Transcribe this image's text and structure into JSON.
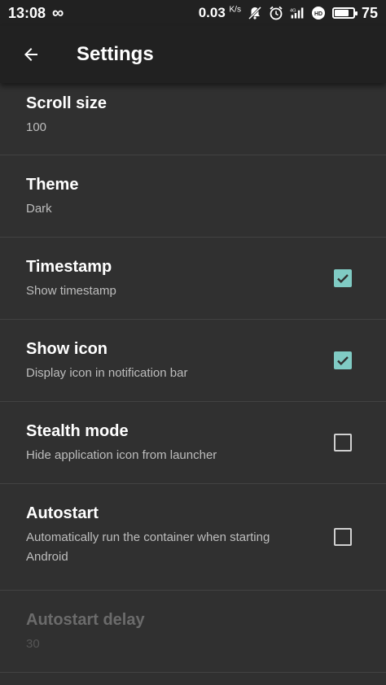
{
  "status_bar": {
    "time": "13:08",
    "infinity": "∞",
    "speed": "0.03",
    "speed_unit": "K/s",
    "battery_pct": "75"
  },
  "app_bar": {
    "title": "Settings"
  },
  "settings": [
    {
      "title": "Scroll size",
      "summary": "100",
      "checkbox": null,
      "enabled": true
    },
    {
      "title": "Theme",
      "summary": "Dark",
      "checkbox": null,
      "enabled": true
    },
    {
      "title": "Timestamp",
      "summary": "Show timestamp",
      "checkbox": true,
      "enabled": true
    },
    {
      "title": "Show icon",
      "summary": "Display icon in notification bar",
      "checkbox": true,
      "enabled": true
    },
    {
      "title": "Stealth mode",
      "summary": "Hide application icon from launcher",
      "checkbox": false,
      "enabled": true
    },
    {
      "title": "Autostart",
      "summary": "Automatically run the container when starting Android",
      "checkbox": false,
      "enabled": true
    },
    {
      "title": "Autostart delay",
      "summary": "30",
      "checkbox": null,
      "enabled": false
    }
  ],
  "colors": {
    "background": "#303030",
    "toolbar": "#212121",
    "accent": "#80cbc4",
    "divider": "#424242"
  }
}
